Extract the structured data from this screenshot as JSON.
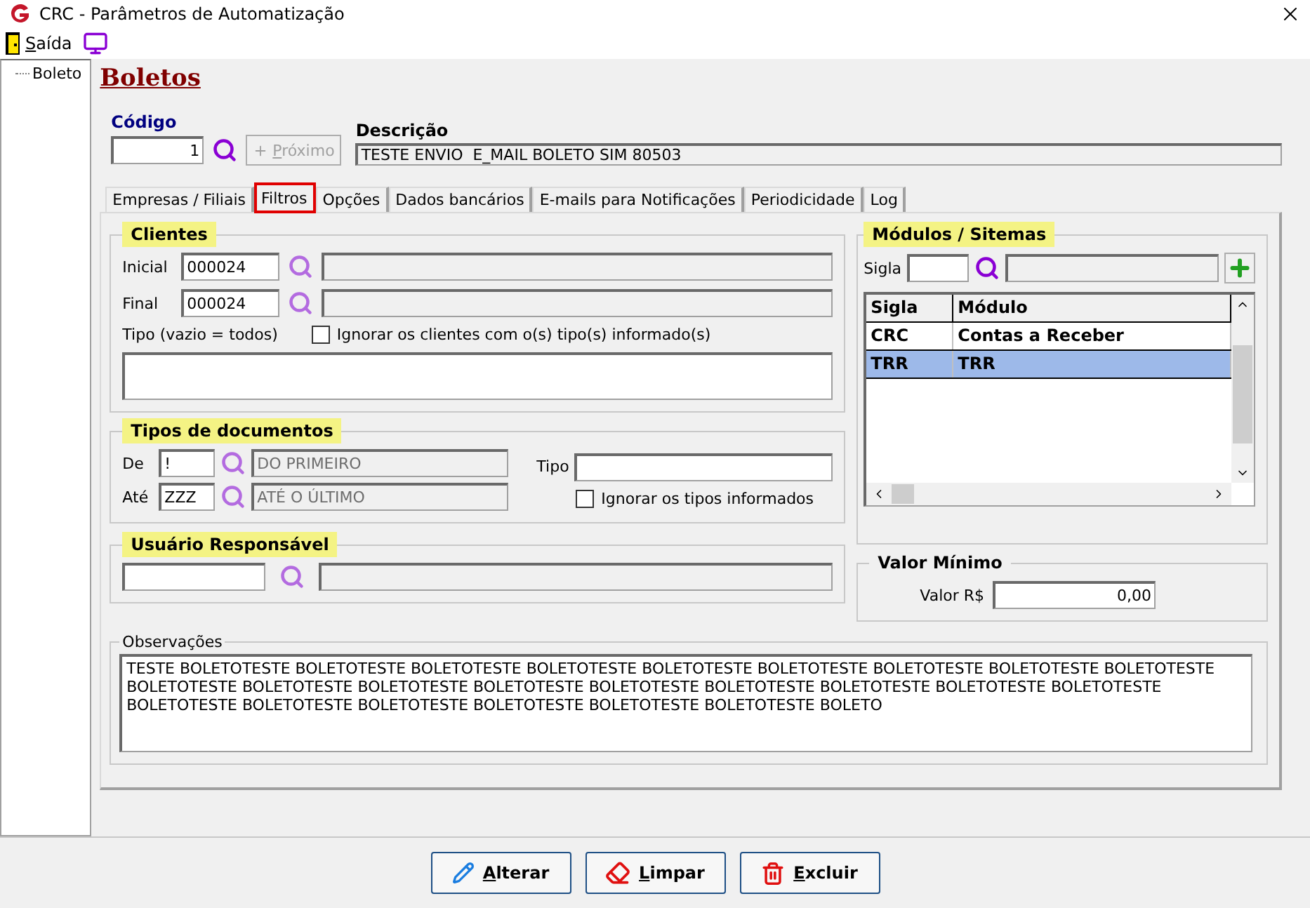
{
  "window": {
    "title": "CRC - Parâmetros de Automatização"
  },
  "menu": {
    "exit_label": "Saída"
  },
  "tree": [
    {
      "label": "Boleto"
    }
  ],
  "heading": "Boletos",
  "codigo": {
    "label": "Código",
    "value": "1"
  },
  "next_button": {
    "label": "Próximo",
    "disabled": true
  },
  "descricao": {
    "label": "Descrição",
    "value": "TESTE ENVIO  E_MAIL BOLETO SIM 80503"
  },
  "tabs": [
    {
      "label": "Empresas / Filiais",
      "selected": false
    },
    {
      "label": "Filtros",
      "selected": true
    },
    {
      "label": "Opções",
      "selected": false
    },
    {
      "label": "Dados bancários",
      "selected": false
    },
    {
      "label": "E-mails para Notificações",
      "selected": false
    },
    {
      "label": "Periodicidade",
      "selected": false
    },
    {
      "label": "Log",
      "selected": false
    }
  ],
  "clientes": {
    "title": "Clientes",
    "highlighted": true,
    "inicial": {
      "label": "Inicial",
      "value": "000024"
    },
    "final": {
      "label": "Final",
      "value": "000024"
    },
    "tipo_label": "Tipo (vazio = todos)",
    "ignore": {
      "label": "Ignorar os clientes com o(s) tipo(s) informado(s)",
      "checked": false
    }
  },
  "tipos_documentos": {
    "title": "Tipos de documentos",
    "highlighted": true,
    "de": {
      "label": "De",
      "value": "!",
      "description": "DO PRIMEIRO"
    },
    "ate": {
      "label": "Até",
      "value": "ZZZ",
      "description": "ATÉ O ÚLTIMO"
    },
    "tipo_label": "Tipo",
    "ignore": {
      "label": "Ignorar os tipos informados",
      "checked": false
    }
  },
  "usuario": {
    "title": "Usuário Responsável",
    "highlighted": true
  },
  "modulos": {
    "title": "Módulos / Sitemas",
    "highlighted": true,
    "sigla_label": "Sigla",
    "columns": [
      "Sigla",
      "Módulo"
    ],
    "rows": [
      {
        "cells": [
          "CRC",
          "Contas a Receber"
        ],
        "selected": false
      },
      {
        "cells": [
          "TRR",
          "TRR"
        ],
        "selected": true
      }
    ]
  },
  "valor_minimo": {
    "title": "Valor Mínimo",
    "highlighted": false,
    "label": "Valor R$",
    "value": "0,00"
  },
  "observacoes": {
    "title": "Observações",
    "text": "TESTE BOLETOTESTE BOLETOTESTE BOLETOTESTE BOLETOTESTE BOLETOTESTE BOLETOTESTE BOLETOTESTE BOLETOTESTE BOLETOTESTE BOLETOTESTE BOLETOTESTE BOLETOTESTE BOLETOTESTE BOLETOTESTE BOLETOTESTE BOLETOTESTE BOLETOTESTE BOLETOTESTE BOLETOTESTE BOLETOTESTE BOLETOTESTE BOLETOTESTE BOLETOTESTE BOLETOTESTE BOLETO"
  },
  "buttons": [
    {
      "label": "Alterar",
      "kind": "edit"
    },
    {
      "label": "Limpar",
      "kind": "clear"
    },
    {
      "label": "Excluir",
      "kind": "delete"
    }
  ]
}
